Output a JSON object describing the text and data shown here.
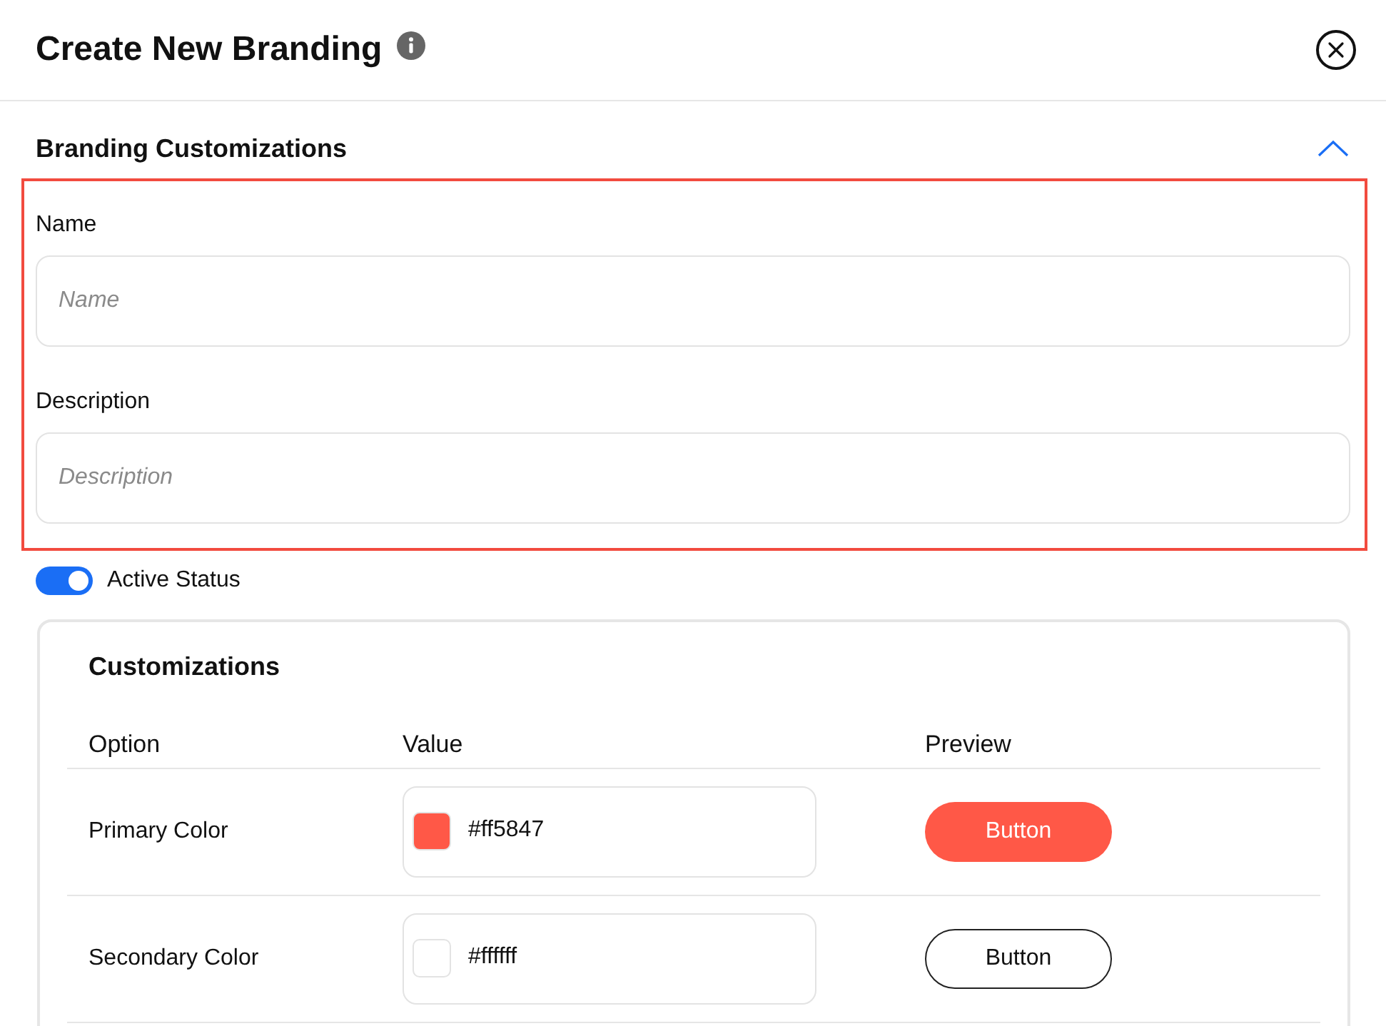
{
  "header": {
    "title": "Create New Branding"
  },
  "section": {
    "title": "Branding Customizations",
    "expanded": true,
    "highlighted": true,
    "fields": [
      {
        "label": "Name",
        "placeholder": "Name"
      },
      {
        "label": "Description",
        "placeholder": "Description"
      }
    ]
  },
  "active_status": {
    "label": "Active Status",
    "on": true
  },
  "customizations": {
    "title": "Customizations",
    "columns": [
      "Option",
      "Value",
      "Preview"
    ],
    "rows": [
      {
        "kind": "filled",
        "option": "Primary Color",
        "value": "#ff5847",
        "color": "#ff5847",
        "preview": "Button"
      },
      {
        "kind": "outlined",
        "option": "Secondary Color",
        "value": "#ffffff",
        "color": "#ffffff",
        "preview": "Button"
      }
    ]
  }
}
